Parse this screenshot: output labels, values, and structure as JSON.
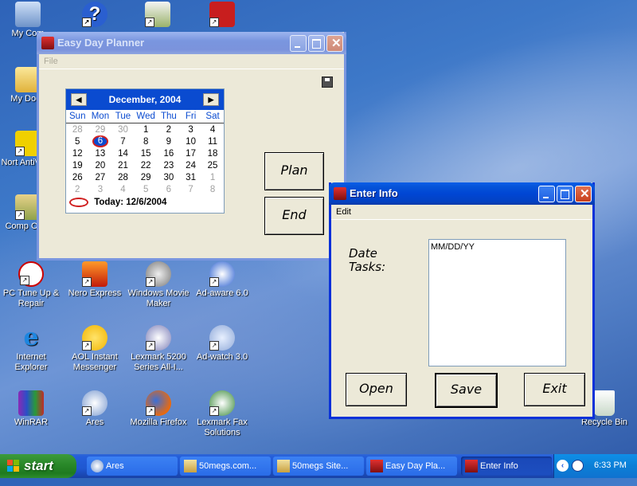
{
  "desktop": {
    "icons": [
      {
        "label": "My Com"
      },
      {
        "label": ""
      },
      {
        "label": ""
      },
      {
        "label": ""
      },
      {
        "label": "My Docu"
      },
      {
        "label": "Nort AntiVirus"
      },
      {
        "label": "Comp Orga"
      },
      {
        "label": "PC Tune Up & Repair"
      },
      {
        "label": "Nero Express"
      },
      {
        "label": "Windows Movie Maker"
      },
      {
        "label": "Ad-aware 6.0"
      },
      {
        "label": "Internet Explorer"
      },
      {
        "label": "AOL Instant Messenger"
      },
      {
        "label": "Lexmark 5200 Series All-I..."
      },
      {
        "label": "Ad-watch 3.0"
      },
      {
        "label": "WinRAR"
      },
      {
        "label": "Ares"
      },
      {
        "label": "Mozilla Firefox"
      },
      {
        "label": "Lexmark Fax Solutions"
      },
      {
        "label": "Recycle Bin"
      }
    ]
  },
  "planner": {
    "title": "Easy Day Planner",
    "menu_file": "File",
    "plan_button": "Plan",
    "end_button": "End",
    "calendar": {
      "month_label": "December, 2004",
      "prev": "◀",
      "next": "▶",
      "weekdays": [
        "Sun",
        "Mon",
        "Tue",
        "Wed",
        "Thu",
        "Fri",
        "Sat"
      ],
      "weeks": [
        [
          "28",
          "29",
          "30",
          "1",
          "2",
          "3",
          "4"
        ],
        [
          "5",
          "6",
          "7",
          "8",
          "9",
          "10",
          "11"
        ],
        [
          "12",
          "13",
          "14",
          "15",
          "16",
          "17",
          "18"
        ],
        [
          "19",
          "20",
          "21",
          "22",
          "23",
          "24",
          "25"
        ],
        [
          "26",
          "27",
          "28",
          "29",
          "30",
          "31",
          "1"
        ],
        [
          "2",
          "3",
          "4",
          "5",
          "6",
          "7",
          "8"
        ]
      ],
      "today_label": "Today: 12/6/2004"
    }
  },
  "enterinfo": {
    "title": "Enter Info",
    "menu_edit": "Edit",
    "date_label": "Date",
    "tasks_label": "Tasks:",
    "textarea_value": "MM/DD/YY",
    "open_button": "Open",
    "save_button": "Save",
    "exit_button": "Exit"
  },
  "taskbar": {
    "start_label": "start",
    "tasks": [
      "Ares",
      "50megs.com...",
      "50megs Site...",
      "Easy Day Pla...",
      "Enter Info"
    ],
    "clock": "6:33 PM"
  },
  "colors": {
    "title_active": "#0553d8",
    "title_inactive": "#7a96df",
    "calendar_header": "#0a4bd0",
    "window_bg": "#ece9d8",
    "start_green": "#2b8a2b"
  }
}
